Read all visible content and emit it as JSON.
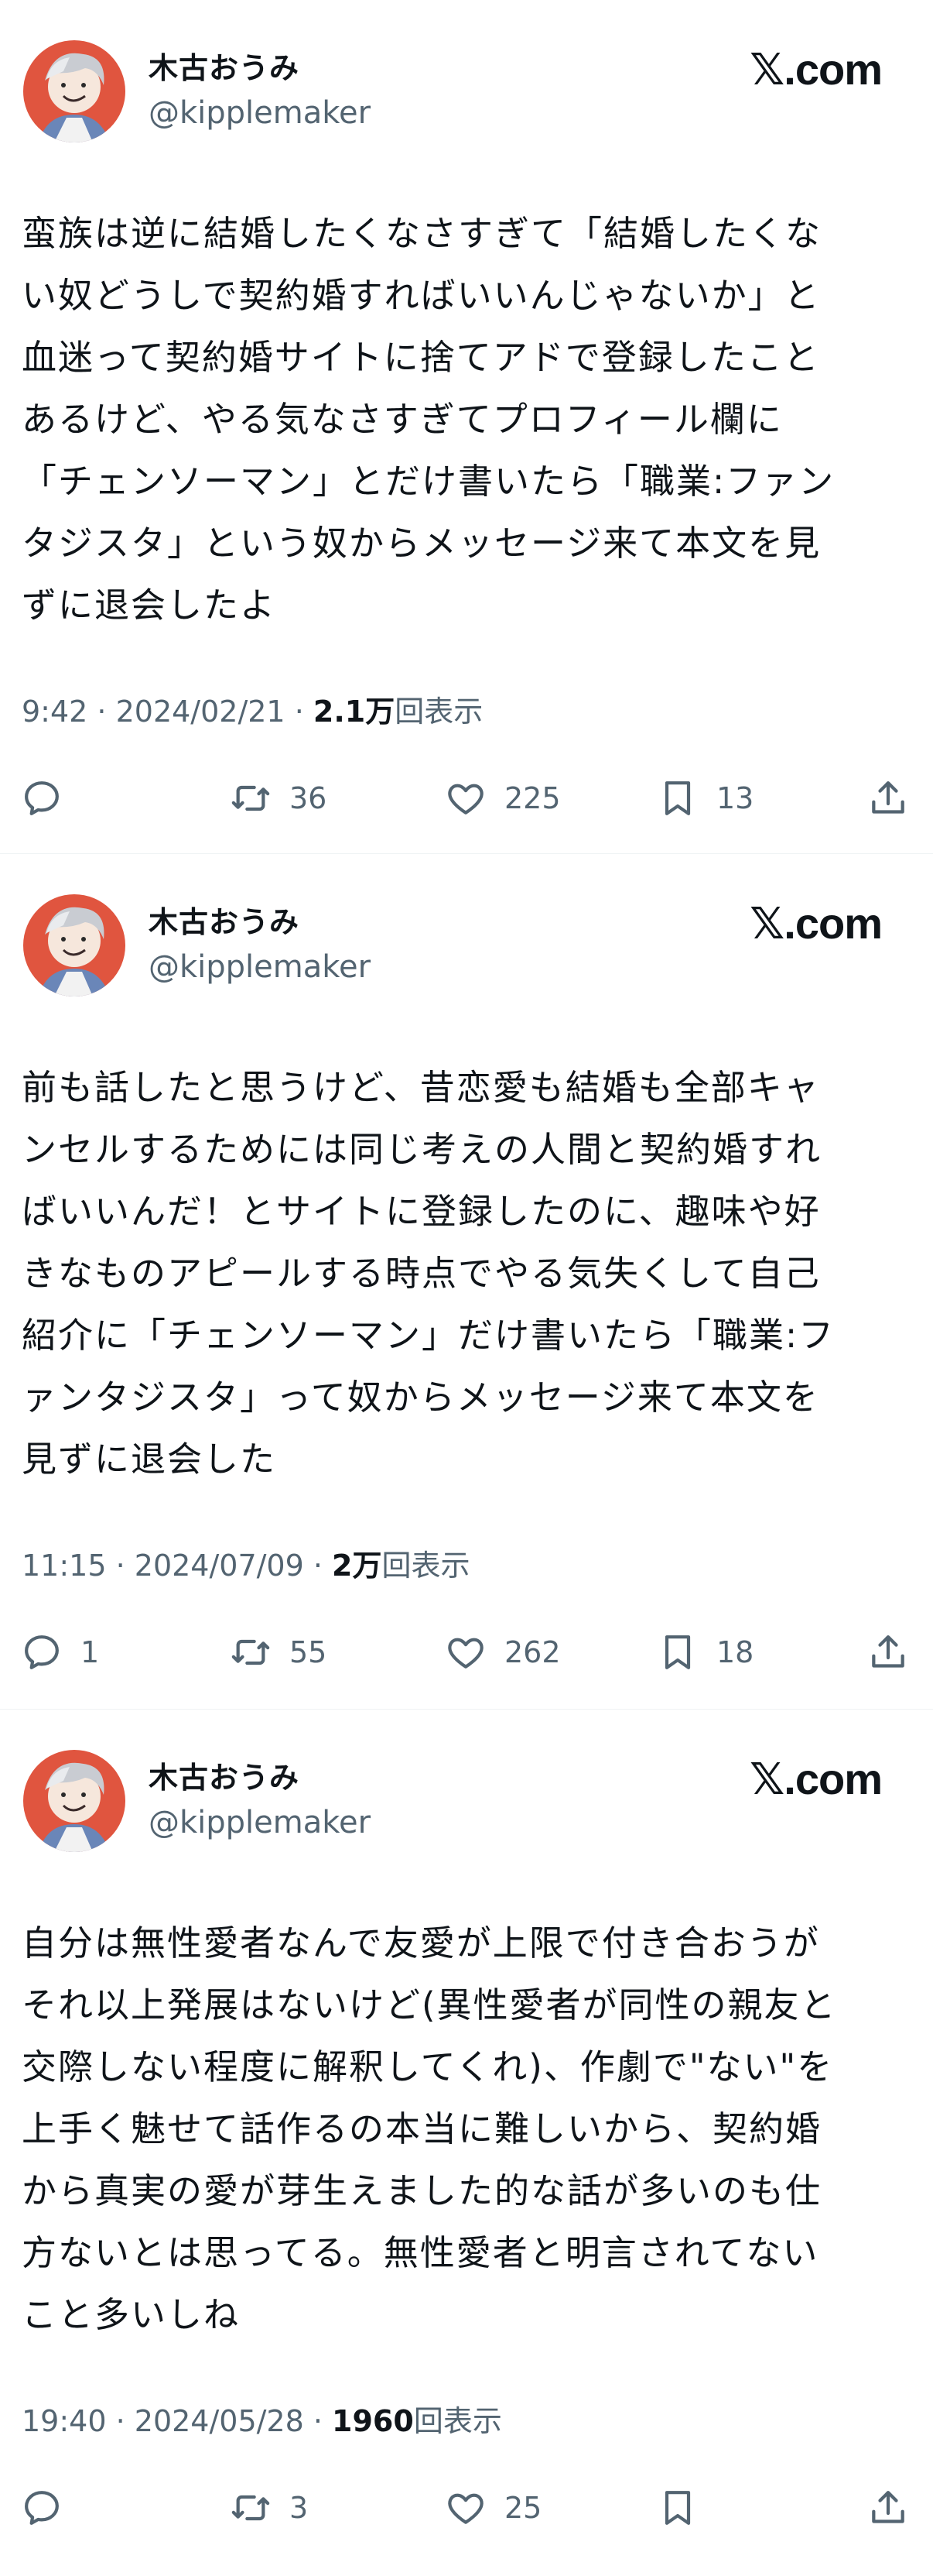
{
  "tweets": [
    {
      "name": "木古おうみ",
      "handle": "@kipplemaker",
      "brand": "𝕏.com",
      "body": "蛮族は逆に結婚したくなさすぎて「結婚したくな\nい奴どうしで契約婚すればいいんじゃないか」と\n血迷って契約婚サイトに捨てアドで登録したこと\nあるけど、やる気なさすぎてプロフィール欄に\n「チェンソーマン」とだけ書いたら「職業:ファン\nタジスタ」という奴からメッセージ来て本文を見\nずに退会したよ",
      "time": "9:42",
      "date": "2024/02/21",
      "views": "2.1万",
      "views_label": "回表示",
      "replies": "",
      "retweets": "36",
      "likes": "225",
      "bookmarks": "13"
    },
    {
      "name": "木古おうみ",
      "handle": "@kipplemaker",
      "brand": "𝕏.com",
      "body": "前も話したと思うけど、昔恋愛も結婚も全部キャ\nンセルするためには同じ考えの人間と契約婚すれ\nばいいんだ！とサイトに登録したのに、趣味や好\nきなものアピールする時点でやる気失くして自己\n紹介に「チェンソーマン」だけ書いたら「職業:フ\nァンタジスタ」って奴からメッセージ来て本文を\n見ずに退会した",
      "time": "11:15",
      "date": "2024/07/09",
      "views": "2万",
      "views_label": "回表示",
      "replies": "1",
      "retweets": "55",
      "likes": "262",
      "bookmarks": "18"
    },
    {
      "name": "木古おうみ",
      "handle": "@kipplemaker",
      "brand": "𝕏.com",
      "body": "自分は無性愛者なんで友愛が上限で付き合おうが\nそれ以上発展はないけど(異性愛者が同性の親友と\n交際しない程度に解釈してくれ)、作劇で\"ない\"を\n上手く魅せて話作るの本当に難しいから、契約婚\nから真実の愛が芽生えました的な話が多いのも仕\n方ないとは思ってる。無性愛者と明言されてない\nこと多いしね",
      "time": "19:40",
      "date": "2024/05/28",
      "views": "1960",
      "views_label": "回表示",
      "replies": "",
      "retweets": "3",
      "likes": "25",
      "bookmarks": ""
    }
  ],
  "separator": " · ",
  "colors": {
    "text": "#0f1419",
    "secondary": "#536471",
    "divider": "#eff3f4",
    "avatar_bg": "#e0553f"
  },
  "icons": [
    "reply-icon",
    "retweet-icon",
    "like-icon",
    "bookmark-icon",
    "share-icon"
  ]
}
